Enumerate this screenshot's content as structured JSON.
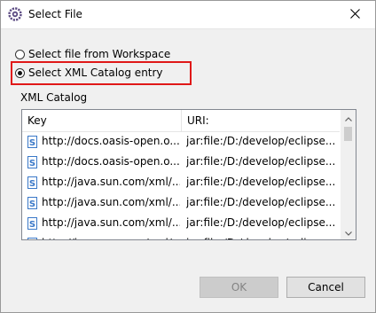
{
  "window": {
    "title": "Select File"
  },
  "options": [
    {
      "label": "Select file from Workspace",
      "checked": false
    },
    {
      "label": "Select XML Catalog entry",
      "checked": true
    }
  ],
  "catalog": {
    "group_label": "XML Catalog",
    "columns": [
      "Key",
      "URI:"
    ],
    "rows": [
      {
        "key": "http://docs.oasis-open.o...",
        "uri": "jar:file:/D:/develop/eclipse..."
      },
      {
        "key": "http://docs.oasis-open.o...",
        "uri": "jar:file:/D:/develop/eclipse..."
      },
      {
        "key": "http://java.sun.com/xml/...",
        "uri": "jar:file:/D:/develop/eclipse..."
      },
      {
        "key": "http://java.sun.com/xml/...",
        "uri": "jar:file:/D:/develop/eclipse..."
      },
      {
        "key": "http://java.sun.com/xml/...",
        "uri": "jar:file:/D:/develop/eclipse..."
      },
      {
        "key": "http://java.sun.com/xml/...",
        "uri": "jar:file:/D:/develop/eclipse..."
      }
    ]
  },
  "buttons": {
    "ok": "OK",
    "cancel": "Cancel"
  },
  "colors": {
    "highlight": "#e01818",
    "file_icon": "#3a78c8"
  },
  "icons": {
    "app": "eclipse-gear-icon",
    "close": "close-icon",
    "row": "xml-schema-file-icon"
  }
}
